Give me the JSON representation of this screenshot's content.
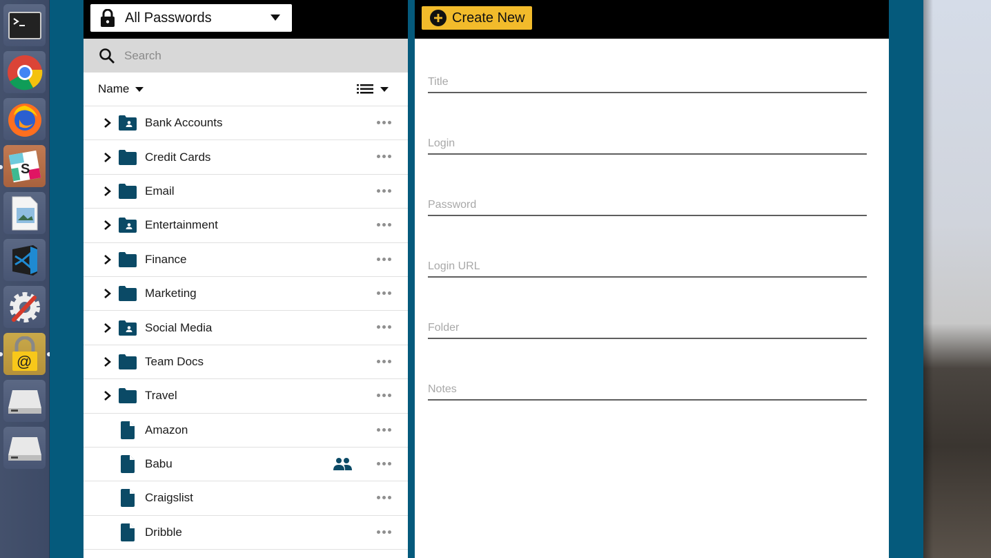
{
  "dock": {
    "items": [
      {
        "name": "terminal",
        "active": false
      },
      {
        "name": "chrome",
        "active": false
      },
      {
        "name": "firefox",
        "active": false
      },
      {
        "name": "slack",
        "active": false
      },
      {
        "name": "image-viewer",
        "active": false
      },
      {
        "name": "vscode",
        "active": false
      },
      {
        "name": "system-settings",
        "active": false
      },
      {
        "name": "password-manager",
        "active": true
      },
      {
        "name": "drive",
        "active": false
      },
      {
        "name": "drive",
        "active": false
      }
    ]
  },
  "left": {
    "vault_selector": {
      "label": "All Passwords"
    },
    "search": {
      "placeholder": "Search",
      "value": ""
    },
    "sort": {
      "label": "Name"
    },
    "folders": [
      {
        "name": "Bank Accounts",
        "shared_folder": true
      },
      {
        "name": "Credit Cards",
        "shared_folder": false
      },
      {
        "name": "Email",
        "shared_folder": false
      },
      {
        "name": "Entertainment",
        "shared_folder": true
      },
      {
        "name": "Finance",
        "shared_folder": false
      },
      {
        "name": "Marketing",
        "shared_folder": false
      },
      {
        "name": "Social Media",
        "shared_folder": true
      },
      {
        "name": "Team Docs",
        "shared_folder": false
      },
      {
        "name": "Travel",
        "shared_folder": false
      }
    ],
    "records": [
      {
        "name": "Amazon",
        "shared": false
      },
      {
        "name": "Babu",
        "shared": true
      },
      {
        "name": "Craigslist",
        "shared": false
      },
      {
        "name": "Dribble",
        "shared": false
      }
    ]
  },
  "right": {
    "create_button": {
      "label": "Create New"
    },
    "fields": [
      {
        "placeholder": "Title",
        "value": ""
      },
      {
        "placeholder": "Login",
        "value": ""
      },
      {
        "placeholder": "Password",
        "value": ""
      },
      {
        "placeholder": "Login URL",
        "value": ""
      },
      {
        "placeholder": "Folder",
        "value": ""
      },
      {
        "placeholder": "Notes",
        "value": ""
      }
    ]
  },
  "colors": {
    "accent": "#f2bb2b",
    "folder_icon": "#0b4a66",
    "desktop": "#055a7c",
    "header": "#000000"
  }
}
